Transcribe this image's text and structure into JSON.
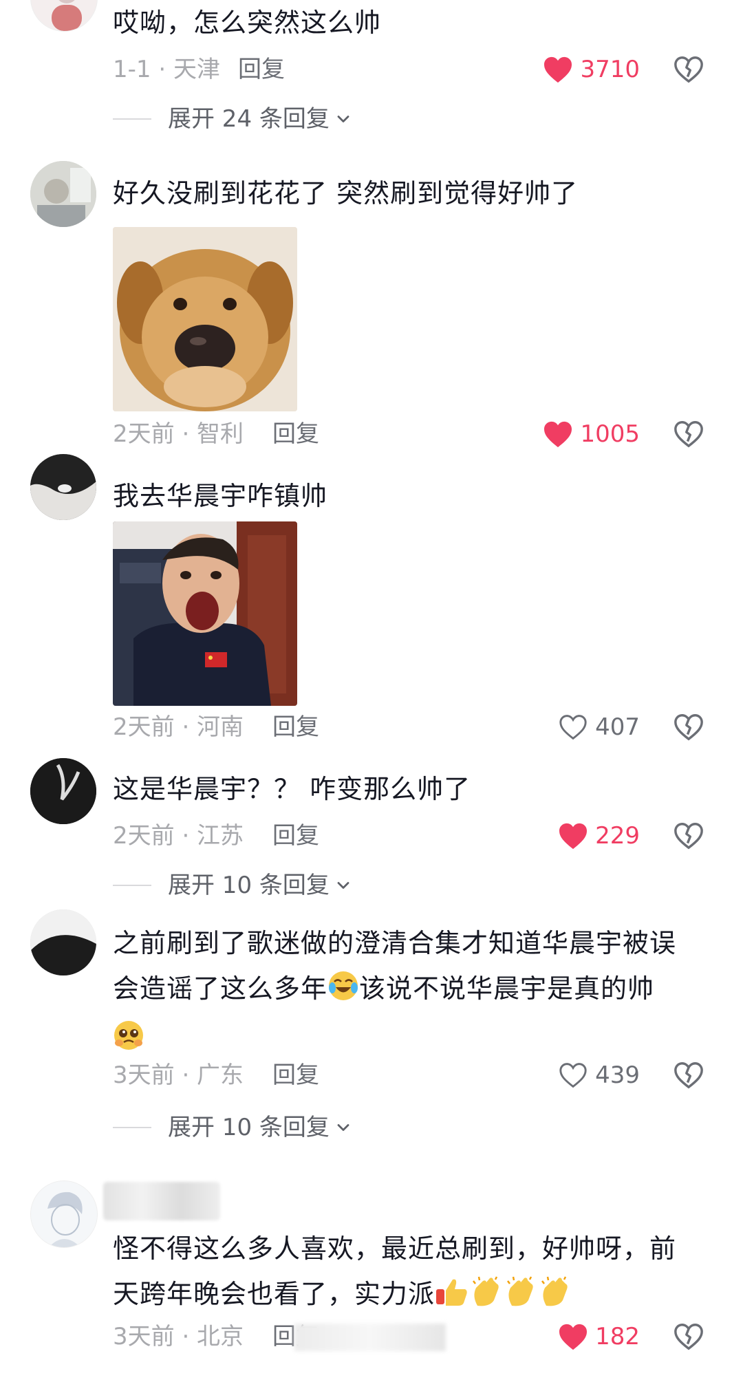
{
  "comments": [
    {
      "text": "哎呦，怎么突然这么帅",
      "meta": "1-1 · 天津",
      "reply": "回复",
      "likes": "3710",
      "liked": true,
      "expand": "展开 24 条回复"
    },
    {
      "text": "好久没刷到花花了 突然刷到觉得好帅了",
      "meta": "2天前 · 智利",
      "reply": "回复",
      "likes": "1005",
      "liked": true,
      "image": "golden-retriever-puppy-meme"
    },
    {
      "text": "我去华晨宇咋镇帅",
      "meta": "2天前 · 河南",
      "reply": "回复",
      "likes": "407",
      "liked": false,
      "image": "surprised-man-meme"
    },
    {
      "text": "这是华晨宇？？ 咋变那么帅了",
      "meta": "2天前 · 江苏",
      "reply": "回复",
      "likes": "229",
      "liked": true,
      "expand": "展开 10 条回复"
    },
    {
      "text_line1": "之前刷到了歌迷做的澄清合集才知道华晨宇被误",
      "text_line2a": "会造谣了这么多年",
      "text_line2b": "该说不说华晨宇是真的帅",
      "emoji1": "crying-laughing-emoji",
      "emoji2": "pleading-eyes-emoji",
      "meta": "3天前 · 广东",
      "reply": "回复",
      "likes": "439",
      "liked": false,
      "expand": "展开 10 条回复"
    },
    {
      "text_line1": "怪不得这么多人喜欢，最近总刷到，好帅呀，前",
      "text_line2": "天跨年晚会也看了，实力派",
      "emojis": [
        "thumbs-up-emoji",
        "clapping-hands-emoji",
        "clapping-hands-emoji",
        "clapping-hands-emoji"
      ],
      "meta": "3天前 · 北京",
      "reply": "回复",
      "likes": "182",
      "liked": true
    }
  ],
  "colors": {
    "liked": "#f03d62",
    "meta": "#a8a9ad",
    "text": "#161823"
  }
}
